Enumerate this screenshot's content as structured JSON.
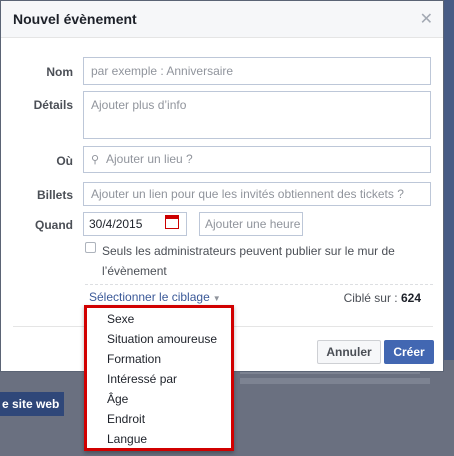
{
  "dialog": {
    "title": "Nouvel évènement",
    "close_icon": "close-icon"
  },
  "form": {
    "name_label": "Nom",
    "name_placeholder": "par exemple : Anniversaire",
    "details_label": "Détails",
    "details_placeholder": "Ajouter plus d’info",
    "where_label": "Où",
    "where_placeholder": "Ajouter un lieu ?",
    "tickets_label": "Billets",
    "tickets_placeholder": "Ajouter un lien pour que les invités obtiennent des tickets ?",
    "when_label": "Quand",
    "date_value": "30/4/2015",
    "time_placeholder": "Ajouter une heure",
    "admin_checkbox_label": "Seuls les administrateurs peuvent publier sur le mur de l’évènement",
    "admin_checked": false
  },
  "targeting": {
    "link_label": "Sélectionner le ciblage",
    "cible_label": "Ciblé sur :",
    "cible_count": "624",
    "menu_items": [
      "Sexe",
      "Situation amoureuse",
      "Formation",
      "Intéressé par",
      "Âge",
      "Endroit",
      "Langue"
    ]
  },
  "footer": {
    "cancel_label": "Annuler",
    "create_label": "Créer"
  },
  "background": {
    "site_button_label": "e site web"
  },
  "colors": {
    "accent": "#4267b2",
    "link": "#3b5998",
    "highlight_border": "#d10000"
  }
}
